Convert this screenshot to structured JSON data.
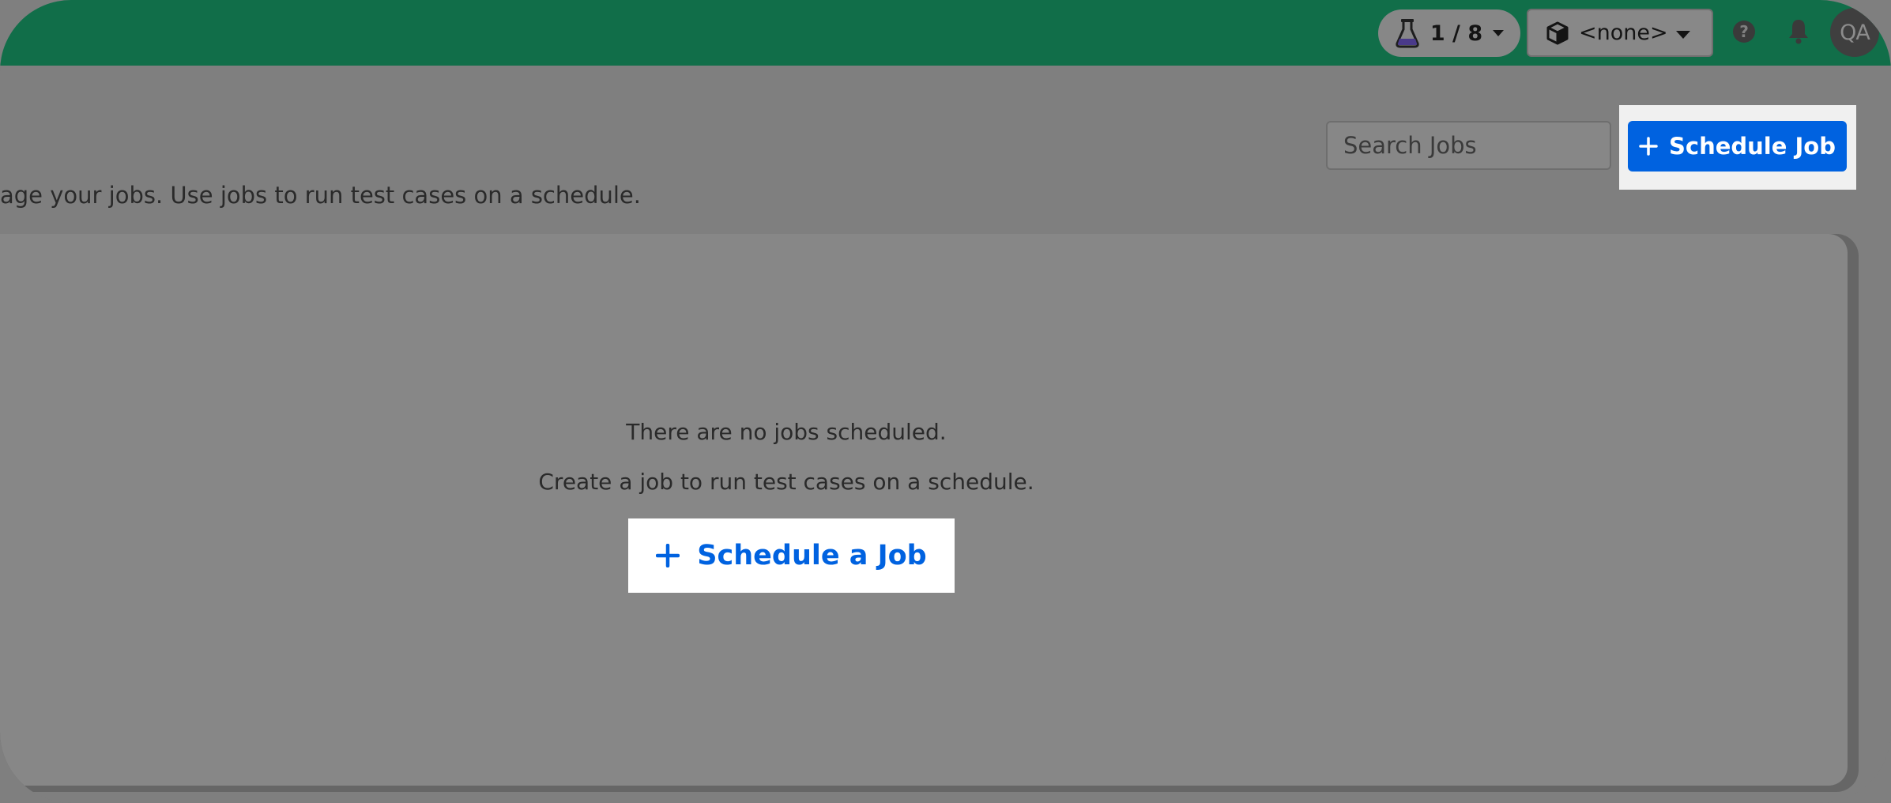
{
  "topbar": {
    "experiments_label": "1 / 8",
    "environment_value": "<none>",
    "avatar_initials": "QA",
    "accent_color": "#116e49"
  },
  "header": {
    "search_placeholder": "Search Jobs",
    "schedule_button_label": "Schedule Job",
    "description": "age your jobs. Use jobs to run test cases on a schedule."
  },
  "empty_state": {
    "title": "There are no jobs scheduled.",
    "subtitle": "Create a job to run test cases on a schedule.",
    "button_label": "Schedule a Job"
  },
  "icons": {
    "experiments": "flask-icon",
    "environment": "cube-icon",
    "help": "help-circle-icon",
    "notifications": "bell-icon",
    "add": "plus-icon"
  },
  "colors": {
    "primary_button": "#0062e0",
    "overlay_gray": "#7f7f7f"
  }
}
